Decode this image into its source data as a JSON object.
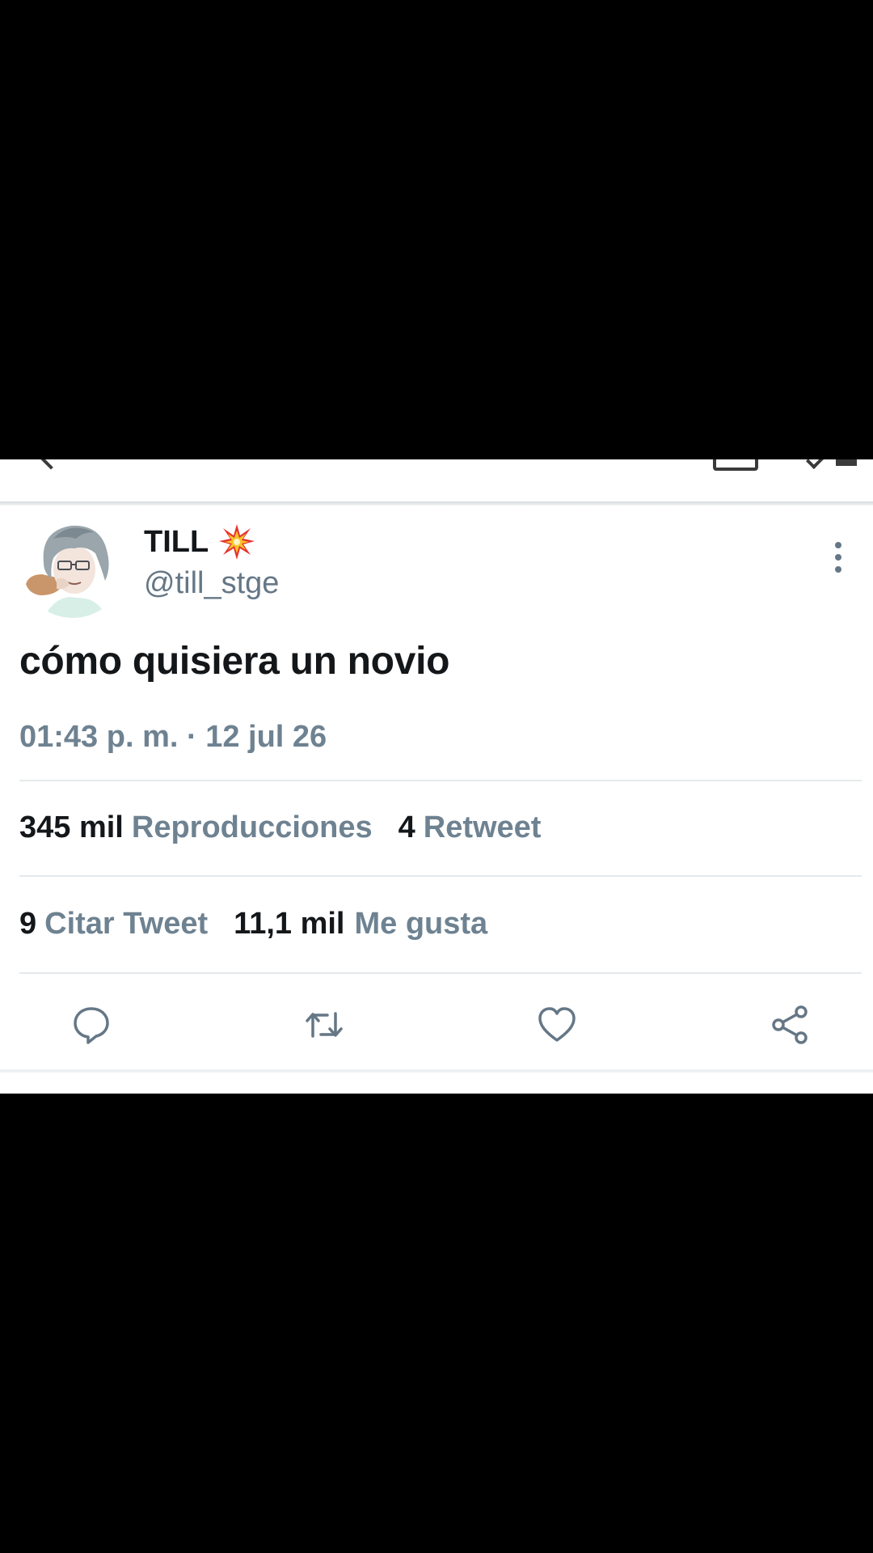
{
  "tweet": {
    "display_name": "TILL",
    "name_emoji_icon": "collision-burst-icon",
    "handle": "@till_stge",
    "text": "cómo quisiera un novio",
    "timestamp": "01:43 p. m. · 12 jul 26"
  },
  "stats": {
    "views_count": "345 mil",
    "views_label": "Reproducciones",
    "retweets_count": "4",
    "retweets_label": "Retweet",
    "quotes_count": "9",
    "quotes_label": "Citar Tweet",
    "likes_count": "11,1 mil",
    "likes_label": "Me gusta"
  },
  "actions": [
    {
      "name": "reply",
      "icon": "reply-bubble-icon"
    },
    {
      "name": "retweet",
      "icon": "retweet-arrows-icon"
    },
    {
      "name": "like",
      "icon": "heart-icon"
    },
    {
      "name": "share",
      "icon": "share-nodes-icon"
    }
  ],
  "colors": {
    "primary_text": "#14171a",
    "secondary_text": "#657786",
    "divider": "#e6e9ec",
    "letterbox": "#000000",
    "burst_red": "#e8322d",
    "burst_yellow": "#f7c52b"
  }
}
